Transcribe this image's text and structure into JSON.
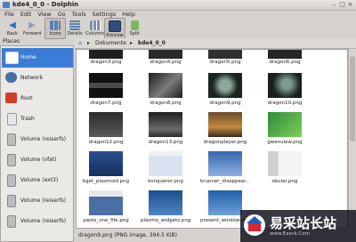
{
  "window": {
    "title": "kde4_0_0 - Dolphin"
  },
  "menu": [
    "File",
    "Edit",
    "View",
    "Go",
    "Tools",
    "Settings",
    "Help"
  ],
  "toolbar": {
    "back": "Back",
    "forward": "Forward",
    "icons": "Icons",
    "details": "Details",
    "columns": "Columns",
    "preview": "Preview",
    "split": "Split"
  },
  "places": {
    "header": "Places",
    "items": [
      "Home",
      "Network",
      "Root",
      "Trash",
      "Volume (reiserfs)",
      "Volume (vfat)",
      "Volume (ext3)",
      "Volume (reiserfs)",
      "Volume (reiserfs)"
    ]
  },
  "breadcrumb": [
    "Dokumente",
    "kde4_0_0"
  ],
  "files": [
    "dragon3.png",
    "dragon4.png",
    "dragon5.png",
    "dragon6.png",
    "dragon7.png",
    "dragon8.png",
    "dragon9.png",
    "dragon10.png",
    "dragon12.png",
    "dragon13.png",
    "dragonplayer.png",
    "gwenview.png",
    "kget_plasmoid.png",
    "konqueror.png",
    "krunner_disappear....",
    "okular.png",
    "paste_one_file.png",
    "plasma_widgets.png",
    "present_windows.p..."
  ],
  "status": "dragon9.png (PNG image, 394.5 KiB)",
  "watermark": {
    "text": "易采站长站",
    "url": "www.Easck.Com"
  }
}
